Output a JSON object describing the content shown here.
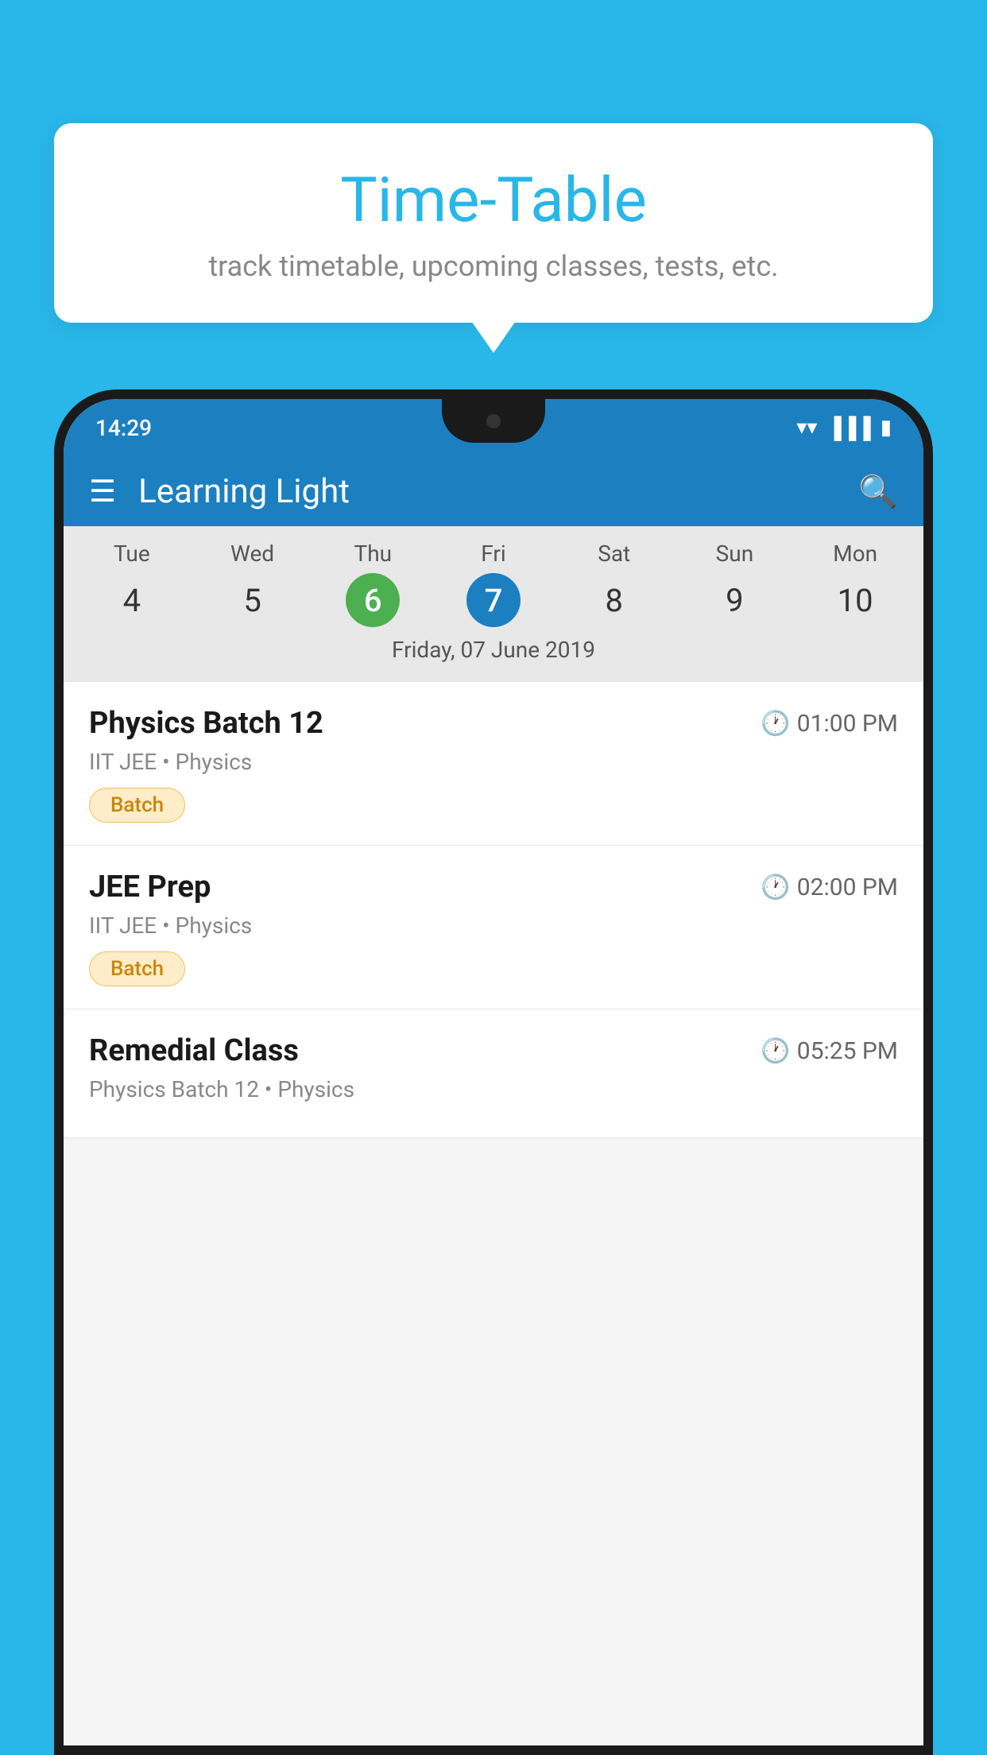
{
  "background_color": "#29b6e8",
  "tooltip": {
    "title": "Time-Table",
    "subtitle": "track timetable, upcoming classes, tests, etc."
  },
  "status_bar": {
    "time": "14:29"
  },
  "app_bar": {
    "title": "Learning Light"
  },
  "calendar": {
    "day_labels": [
      "Tue",
      "Wed",
      "Thu",
      "Fri",
      "Sat",
      "Sun",
      "Mon"
    ],
    "day_numbers": [
      "4",
      "5",
      "6",
      "7",
      "8",
      "9",
      "10"
    ],
    "today_index": 2,
    "selected_index": 3,
    "selected_date_label": "Friday, 07 June 2019"
  },
  "schedule_items": [
    {
      "name": "Physics Batch 12",
      "time": "01:00 PM",
      "meta": "IIT JEE • Physics",
      "badge": "Batch"
    },
    {
      "name": "JEE Prep",
      "time": "02:00 PM",
      "meta": "IIT JEE • Physics",
      "badge": "Batch"
    },
    {
      "name": "Remedial Class",
      "time": "05:25 PM",
      "meta": "Physics Batch 12 • Physics",
      "badge": null
    }
  ]
}
